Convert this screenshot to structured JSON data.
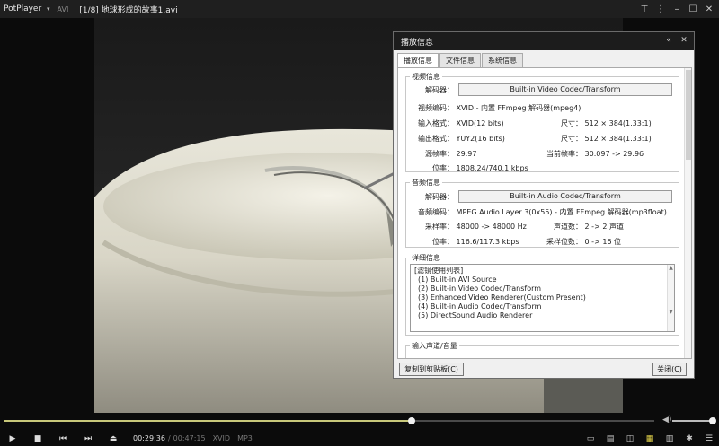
{
  "app": {
    "name": "PotPlayer",
    "format": "AVI",
    "title": "[1/8] 地球形成的故事1.avi"
  },
  "icons": {
    "app_menu": "chevron-down-icon",
    "window_buttons": [
      "pin-icon",
      "tile-icon",
      "minimize-icon",
      "maximize-icon",
      "close-icon"
    ],
    "transport": [
      "play-icon",
      "stop-icon",
      "previous-icon",
      "next-icon",
      "eject-icon"
    ],
    "right_controls": [
      "screen-icon",
      "subtitle-icon",
      "3d-icon",
      "equalizer-icon",
      "chapter-icon",
      "settings-icon",
      "playlist-icon"
    ]
  },
  "playback": {
    "current_time": "00:29:36",
    "separator": "/",
    "total_time": "00:47:15",
    "video_codec": "XVID",
    "audio_codec": "MP3",
    "progress": 0.627,
    "volume": 0.95
  },
  "dialog": {
    "title": "播放信息",
    "tabs": [
      "播放信息",
      "文件信息",
      "系统信息"
    ],
    "active_tab": 0,
    "video": {
      "legend": "视频信息",
      "decoder_label": "解码器：",
      "decoder": "Built-in Video Codec/Transform",
      "codec_label": "视频编码：",
      "codec": "XVID - 内置 FFmpeg 解码器(mpeg4)",
      "input_label": "输入格式：",
      "input": "XVID(12 bits)",
      "input_size_label": "尺寸：",
      "input_size": "512 × 384(1.33:1)",
      "output_label": "输出格式：",
      "output": "YUY2(16 bits)",
      "output_size_label": "尺寸：",
      "output_size": "512 × 384(1.33:1)",
      "fps_label": "源帧率：",
      "fps": "29.97",
      "cur_fps_label": "当前帧率：",
      "cur_fps": "30.097 -> 29.96",
      "bitrate_label": "位率：",
      "bitrate": "1808.24/740.1 kbps"
    },
    "audio": {
      "legend": "音频信息",
      "decoder_label": "解码器：",
      "decoder": "Built-in Audio Codec/Transform",
      "codec_label": "音频编码：",
      "codec": "MPEG Audio Layer 3(0x55) - 内置 FFmpeg 解码器(mp3float)",
      "samplerate_label": "采样率：",
      "samplerate": "48000 -> 48000 Hz",
      "channels_label": "声道数：",
      "channels": "2 -> 2 声道",
      "bitrate_label": "位率：",
      "bitrate": "116.6/117.3 kbps",
      "bits_label": "采样位数：",
      "bits": "0 -> 16 位"
    },
    "details": {
      "legend": "详细信息",
      "items": [
        "[滤镜使用列表]",
        "(1) Built-in AVI Source",
        "(2) Built-in Video Codec/Transform",
        "(3) Enhanced Video Renderer(Custom Present)",
        "(4) Built-in Audio Codec/Transform",
        "(5) DirectSound Audio Renderer"
      ]
    },
    "input_volume": {
      "legend": "输入声道/音量"
    },
    "copy_button": "复制到剪贴板(C)",
    "close_button": "关闭(C)"
  }
}
